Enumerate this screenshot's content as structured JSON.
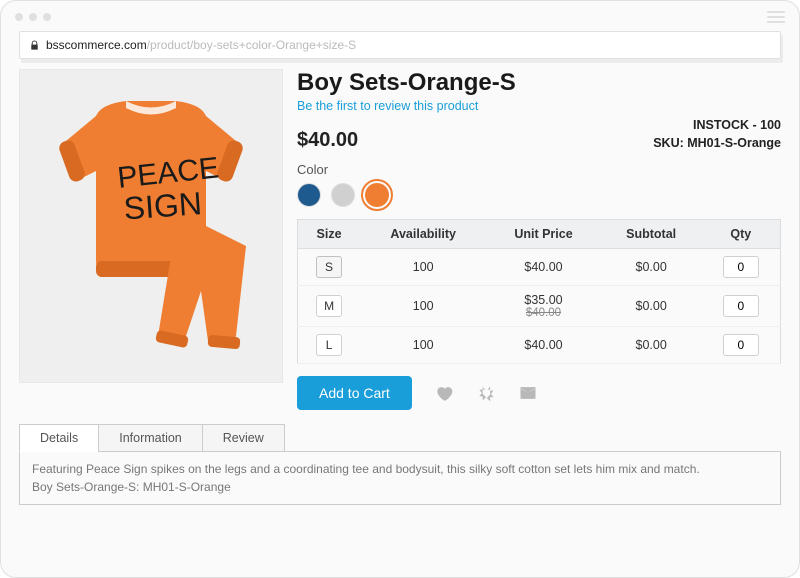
{
  "url": {
    "host": "bsscommerce.com",
    "path": "/product/boy-sets+color-Orange+size-S"
  },
  "product": {
    "title": "Boy Sets-Orange-S",
    "review_prompt": "Be the first to review this product",
    "price": "$40.00",
    "stock": "INSTOCK - 100",
    "sku": "SKU: MH01-S-Orange",
    "color_label": "Color",
    "colors": [
      {
        "hex": "#1f5a8f",
        "selected": false
      },
      {
        "hex": "#d0d0d0",
        "selected": false
      },
      {
        "hex": "#ef7e32",
        "selected": true
      }
    ],
    "grid": {
      "headers": {
        "size": "Size",
        "avail": "Availability",
        "unit": "Unit Price",
        "sub": "Subtotal",
        "qty": "Qty"
      },
      "rows": [
        {
          "size": "S",
          "selected": true,
          "avail": "100",
          "price": "$40.00",
          "price_old": "",
          "sub": "$0.00",
          "qty": "0"
        },
        {
          "size": "M",
          "selected": false,
          "avail": "100",
          "price": "$35.00",
          "price_old": "$40.00",
          "sub": "$0.00",
          "qty": "0"
        },
        {
          "size": "L",
          "selected": false,
          "avail": "100",
          "price": "$40.00",
          "price_old": "",
          "sub": "$0.00",
          "qty": "0"
        }
      ]
    },
    "add_to_cart": "Add to Cart"
  },
  "tabs": {
    "details": "Details",
    "info": "Information",
    "review": "Review"
  },
  "description": {
    "line1": "Featuring Peace Sign spikes on the legs and a coordinating tee and bodysuit, this silky soft cotton set lets him mix and match.",
    "line2": "Boy Sets-Orange-S: MH01-S-Orange"
  }
}
